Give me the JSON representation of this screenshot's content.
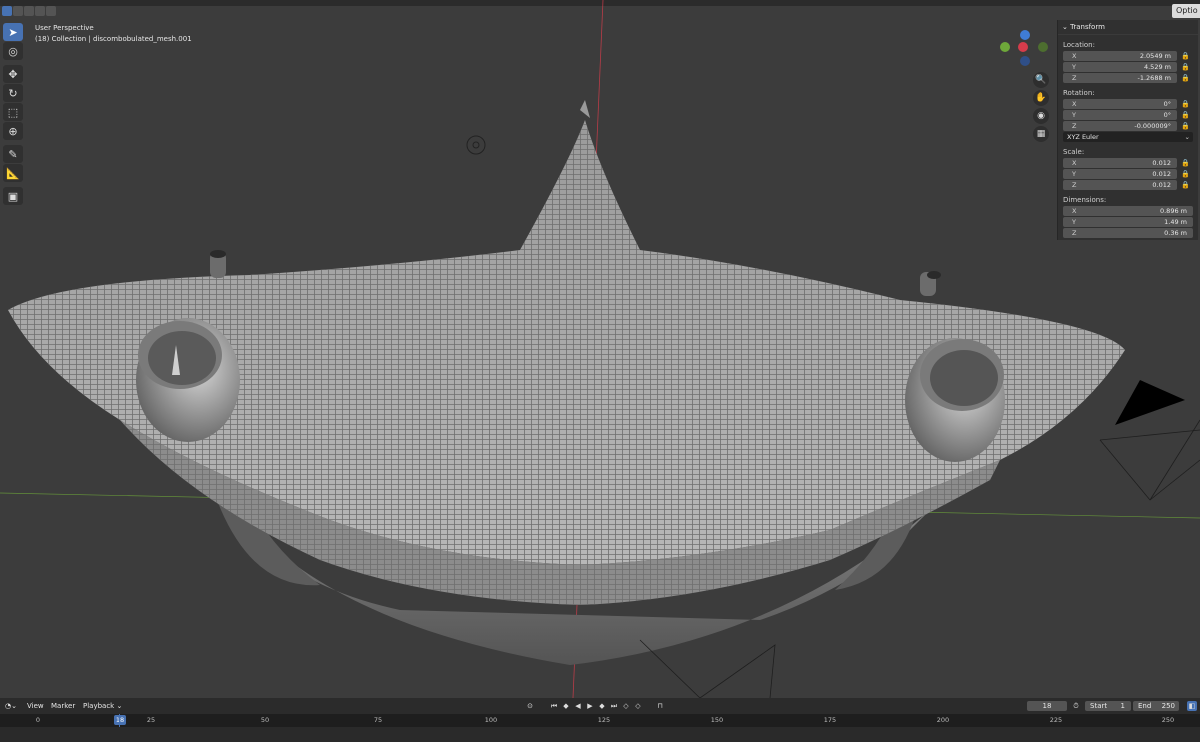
{
  "viewport": {
    "perspective_label": "User Perspective",
    "collection_label": "(18) Collection | discombobulated_mesh.001",
    "options_tab": "Optio"
  },
  "toolbar": {
    "tools": [
      "select-box",
      "cursor",
      "move",
      "rotate",
      "scale",
      "transform",
      "annotate",
      "measure",
      "add-cube"
    ]
  },
  "transform_panel": {
    "header": "Transform",
    "location_label": "Location:",
    "location": [
      {
        "axis": "X",
        "value": "2.0549 m"
      },
      {
        "axis": "Y",
        "value": "4.529 m"
      },
      {
        "axis": "Z",
        "value": "-1.2688 m"
      }
    ],
    "rotation_label": "Rotation:",
    "rotation": [
      {
        "axis": "X",
        "value": "0°"
      },
      {
        "axis": "Y",
        "value": "0°"
      },
      {
        "axis": "Z",
        "value": "-0.000009°"
      }
    ],
    "rotation_mode": "XYZ Euler",
    "scale_label": "Scale:",
    "scale": [
      {
        "axis": "X",
        "value": "0.012"
      },
      {
        "axis": "Y",
        "value": "0.012"
      },
      {
        "axis": "Z",
        "value": "0.012"
      }
    ],
    "dimensions_label": "Dimensions:",
    "dimensions": [
      {
        "axis": "X",
        "value": "0.896 m"
      },
      {
        "axis": "Y",
        "value": "1.49 m"
      },
      {
        "axis": "Z",
        "value": "0.36 m"
      }
    ]
  },
  "timeline": {
    "menu_view": "View",
    "menu_marker": "Marker",
    "menu_playback": "Playback",
    "current_frame": "18",
    "start_label": "Start",
    "start_value": "1",
    "end_label": "End",
    "end_value": "250",
    "ruler_ticks": [
      "0",
      "25",
      "50",
      "75",
      "100",
      "125",
      "150",
      "175",
      "200",
      "225",
      "250"
    ],
    "playhead_label": "18"
  },
  "colors": {
    "accent": "#4772b3",
    "axis_x": "#d63c4b",
    "axis_y": "#6ea83a",
    "axis_z": "#3f7cd4"
  }
}
